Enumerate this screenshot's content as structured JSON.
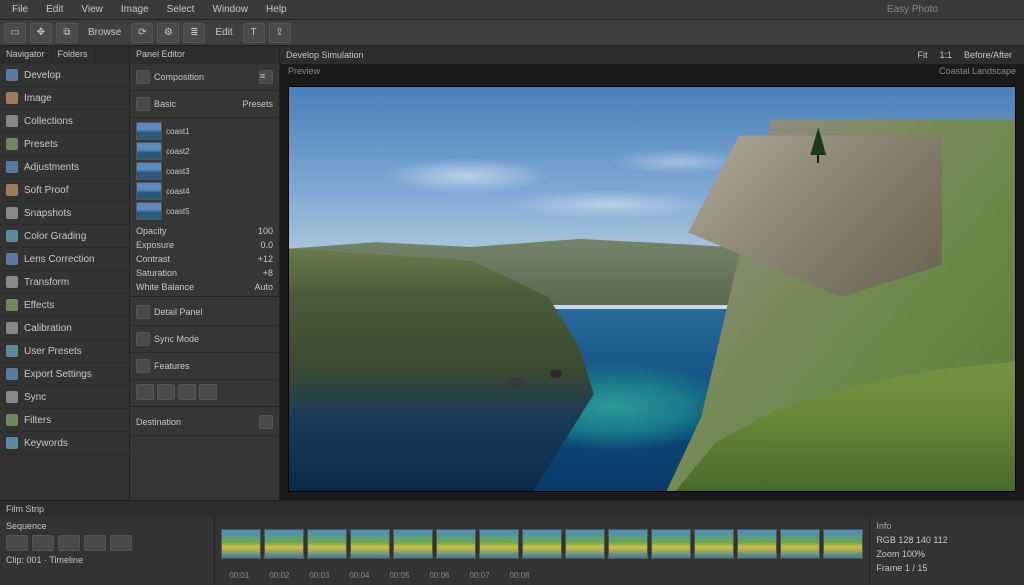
{
  "colors": {
    "bg": "#2a2a2a",
    "panel": "#333",
    "accent": "#5a7aa0"
  },
  "menubar": {
    "items": [
      {
        "label": "File"
      },
      {
        "label": "Edit"
      },
      {
        "label": "View"
      },
      {
        "label": "Image"
      },
      {
        "label": "Select"
      },
      {
        "label": "Window"
      },
      {
        "label": "Help"
      }
    ],
    "title": "Easy Photo"
  },
  "toolbar": {
    "buttons": [
      "pointer",
      "hand",
      "crop",
      "rotate",
      "adjust",
      "layers",
      "text",
      "export"
    ],
    "label1": "Browse",
    "label2": "Edit"
  },
  "sidebar": {
    "tabs": [
      {
        "label": "Navigator"
      },
      {
        "label": "Folders"
      }
    ],
    "items": [
      {
        "icon": "grid-icon",
        "label": "Develop",
        "cls": ""
      },
      {
        "icon": "image-icon",
        "label": "Image",
        "cls": "b"
      },
      {
        "icon": "folder-icon",
        "label": "Collections",
        "cls": "d"
      },
      {
        "icon": "settings-icon",
        "label": "Presets",
        "cls": "c"
      },
      {
        "icon": "adjust-icon",
        "label": "Adjustments",
        "cls": ""
      },
      {
        "icon": "book-icon",
        "label": "Soft Proof",
        "cls": "b"
      },
      {
        "icon": "history-icon",
        "label": "Snapshots",
        "cls": "d"
      },
      {
        "icon": "color-icon",
        "label": "Color Grading",
        "cls": "e"
      },
      {
        "icon": "lens-icon",
        "label": "Lens Correction",
        "cls": ""
      },
      {
        "icon": "crop-icon",
        "label": "Transform",
        "cls": "d"
      },
      {
        "icon": "fx-icon",
        "label": "Effects",
        "cls": "c"
      },
      {
        "icon": "target-icon",
        "label": "Calibration",
        "cls": "d"
      },
      {
        "icon": "preset-icon",
        "label": "User Presets",
        "cls": "e"
      },
      {
        "icon": "export-icon",
        "label": "Export Settings",
        "cls": ""
      },
      {
        "icon": "sync-icon",
        "label": "Sync",
        "cls": "d"
      },
      {
        "icon": "filter-icon",
        "label": "Filters",
        "cls": "c"
      },
      {
        "icon": "keyword-icon",
        "label": "Keywords",
        "cls": "e"
      }
    ]
  },
  "midpanel": {
    "header": "Panel Editor",
    "section1_label": "Composition",
    "basic_label": "Basic",
    "presets_label": "Presets",
    "thumbs": [
      "coast1",
      "coast2",
      "coast3",
      "coast4",
      "coast5"
    ],
    "props": [
      {
        "name": "Opacity",
        "value": "100"
      },
      {
        "name": "Exposure",
        "value": "0.0"
      },
      {
        "name": "Contrast",
        "value": "+12"
      },
      {
        "name": "Saturation",
        "value": "+8"
      },
      {
        "name": "White Balance",
        "value": "Auto"
      }
    ],
    "section2_label": "Detail Panel",
    "section3_label": "Sync Mode",
    "section4_label": "Features",
    "footer_label": "Destination"
  },
  "viewer": {
    "header_left": "Develop Simulation",
    "header_tag": "Preview",
    "header_right_a": "Fit",
    "header_right_b": "1:1",
    "header_right_c": "Before/After",
    "info_label": "Coastal Landscape"
  },
  "bottom": {
    "header": "Film Strip",
    "left_label": "Sequence",
    "meta_label": "Clip: 001 · Timeline",
    "frame_count": 15,
    "timecodes": [
      "00:01",
      "00:02",
      "00:03",
      "00:04",
      "00:05",
      "00:06",
      "00:07",
      "00:08"
    ],
    "right_section": "Info",
    "right_rows": [
      "RGB  128 140 112",
      "Zoom  100%",
      "Frame  1 / 15"
    ]
  }
}
